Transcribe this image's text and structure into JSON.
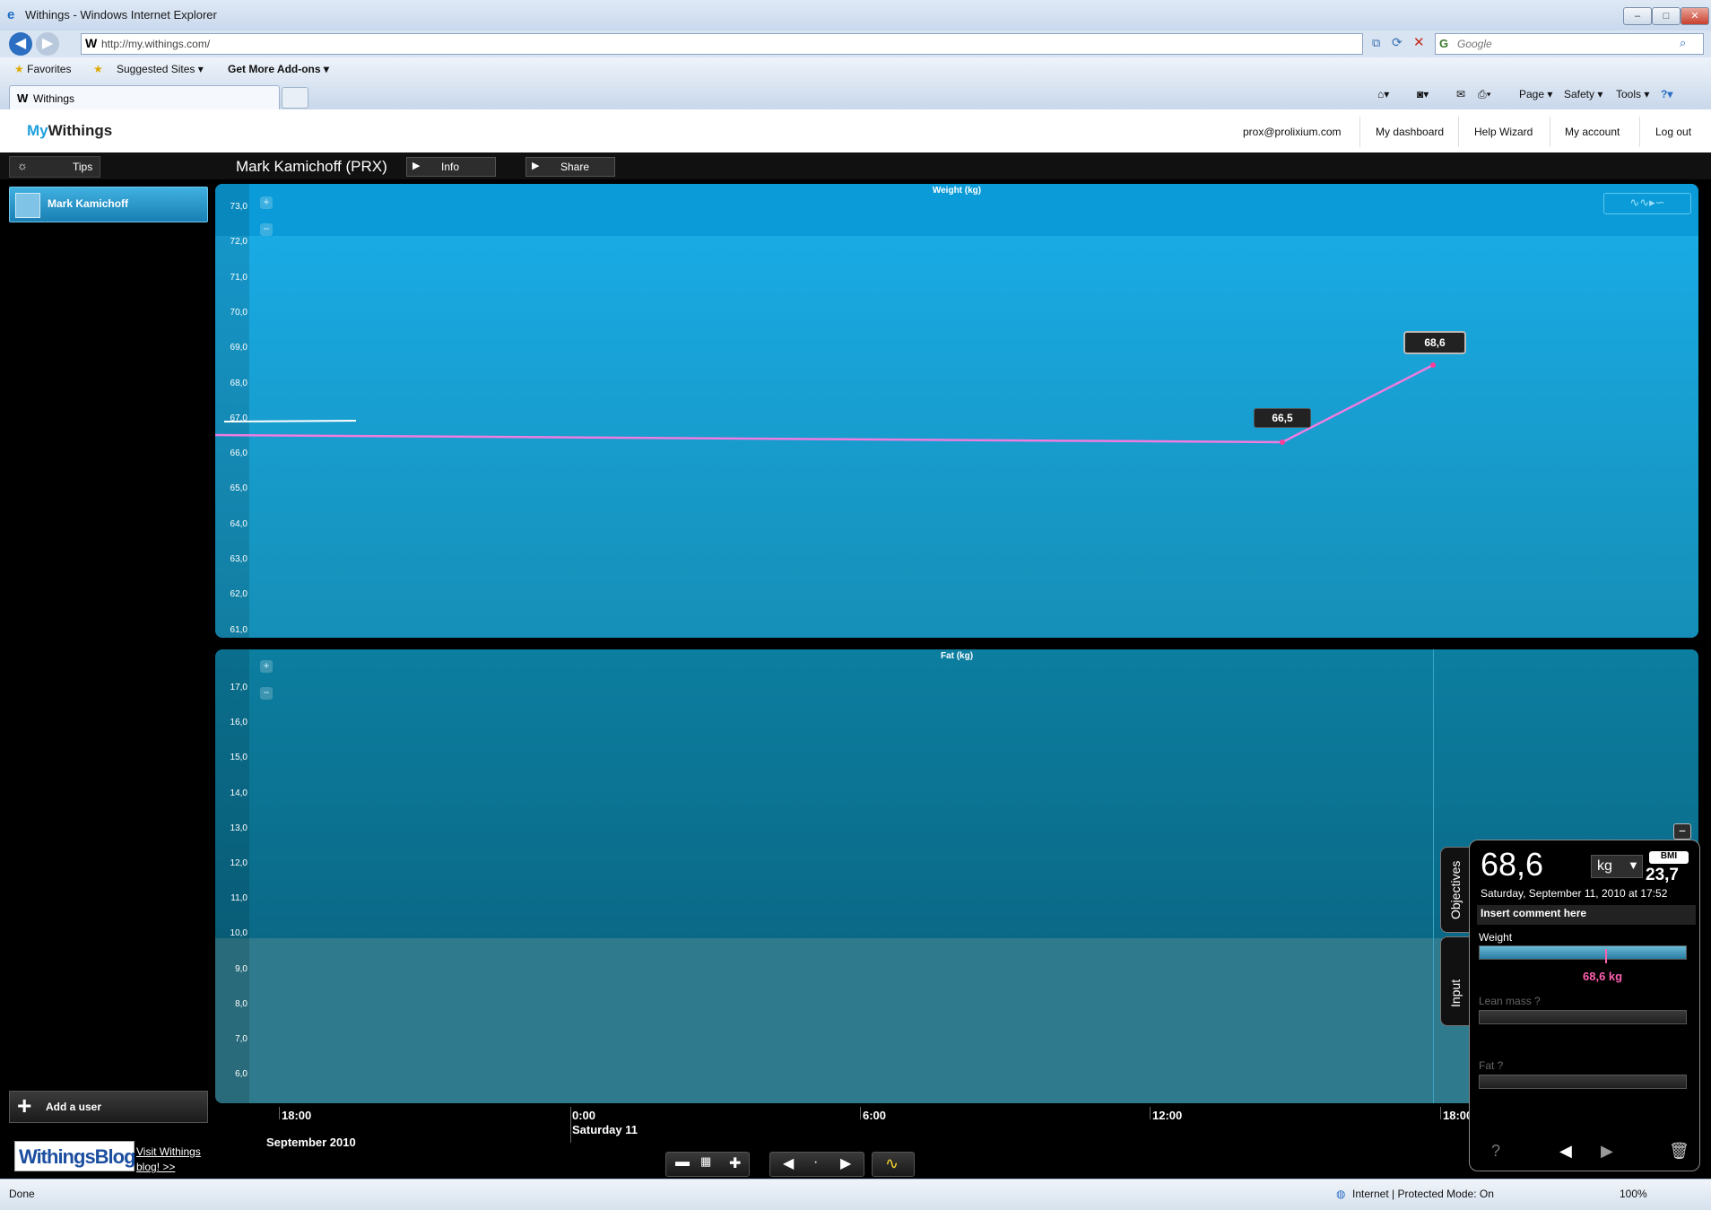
{
  "window": {
    "title": "Withings - Windows Internet Explorer"
  },
  "browser": {
    "address": "http://my.withings.com/",
    "search_placeholder": "Google",
    "favorites_label": "Favorites",
    "suggested_sites": "Suggested Sites",
    "addons": "Get More Add-ons",
    "tab_title": "Withings",
    "tools": [
      "Page",
      "Safety",
      "Tools"
    ],
    "status_left": "Done",
    "status_zone": "Internet | Protected Mode: On",
    "zoom": "100%"
  },
  "header": {
    "logo_my": "My",
    "logo_withings": "Withings",
    "links": [
      "prox@prolixium.com",
      "My dashboard",
      "Help Wizard",
      "My account",
      "Log out"
    ]
  },
  "toolbar": {
    "tips_label": "Tips",
    "user_name": "Mark Kamichoff (PRX)",
    "info_label": "Info",
    "share_label": "Share"
  },
  "sidebar": {
    "user": "Mark Kamichoff",
    "add_user": "Add a user",
    "blog_logo": "WithingsBlog",
    "blog_link": "Visit Withings blog! >>"
  },
  "weight_chart": {
    "title": "Weight (kg)",
    "ticks": [
      "73,0",
      "72,0",
      "71,0",
      "70,0",
      "69,0",
      "68,0",
      "67,0",
      "66,0",
      "65,0",
      "64,0",
      "63,0",
      "62,0",
      "61,0"
    ],
    "labels": [
      "66,5",
      "68,6"
    ],
    "line_color": "#ee7de0",
    "objective_color": "#ffffff"
  },
  "fat_chart": {
    "title": "Fat (kg)",
    "ticks": [
      "17,0",
      "16,0",
      "15,0",
      "14,0",
      "13,0",
      "12,0",
      "11,0",
      "10,0",
      "9,0",
      "8,0",
      "7,0",
      "6,0"
    ]
  },
  "xaxis": {
    "ticks": [
      "18:00",
      "0:00",
      "6:00",
      "12:00",
      "18:00"
    ],
    "day": "Saturday 11",
    "month": "September 2010"
  },
  "panel": {
    "tab_objectives": "Objectives",
    "tab_input": "Input",
    "value": "68,6",
    "unit": "kg",
    "bmi_label": "BMI",
    "bmi_value": "23,7",
    "date": "Saturday, September 11, 2010 at 17:52",
    "comment_placeholder": "Insert comment here",
    "weight_label": "Weight",
    "weight_value": "68,6 kg",
    "lean_label": "Lean mass ?",
    "fat_label": "Fat ?",
    "help": "?"
  },
  "colors": {
    "accent": "#1fa0dc",
    "highlight": "#ff5fb0"
  }
}
